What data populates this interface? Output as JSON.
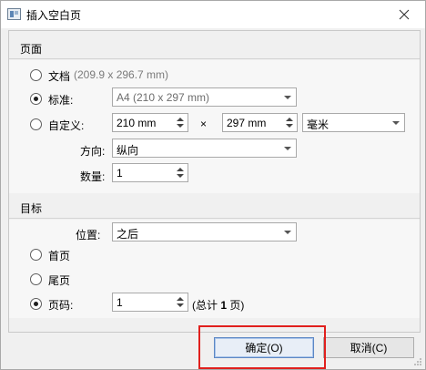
{
  "window": {
    "title": "插入空白页"
  },
  "page_section": {
    "header": "页面",
    "options": {
      "document_label": "文档",
      "document_size": "(209.9 x 296.7 mm)",
      "standard_label": "标准:",
      "standard_value": "A4 (210 x 297 mm)",
      "custom_label": "自定义:",
      "custom_width": "210 mm",
      "times_sign": "×",
      "custom_height": "297 mm",
      "unit_value": "毫米"
    },
    "selected_option": "standard",
    "orientation_label": "方向:",
    "orientation_value": "纵向",
    "count_label": "数量:",
    "count_value": "1"
  },
  "target_section": {
    "header": "目标",
    "position_label": "位置:",
    "position_value": "之后",
    "first_page_label": "首页",
    "last_page_label": "尾页",
    "page_number_label": "页码:",
    "page_number_value": "1",
    "total_prefix": "(总计 ",
    "total_count": "1",
    "total_suffix": " 页)",
    "selected_option": "page_number"
  },
  "buttons": {
    "ok_label": "确定(O)",
    "cancel_label": "取消(C)"
  },
  "annotation": {
    "highlight_color": "#e0201d"
  },
  "icons": {
    "app": "app-window-icon",
    "close": "close-icon",
    "dropdown": "chevron-down-icon",
    "spinner": "spin-arrows-icon",
    "resize": "resize-grip-icon"
  }
}
